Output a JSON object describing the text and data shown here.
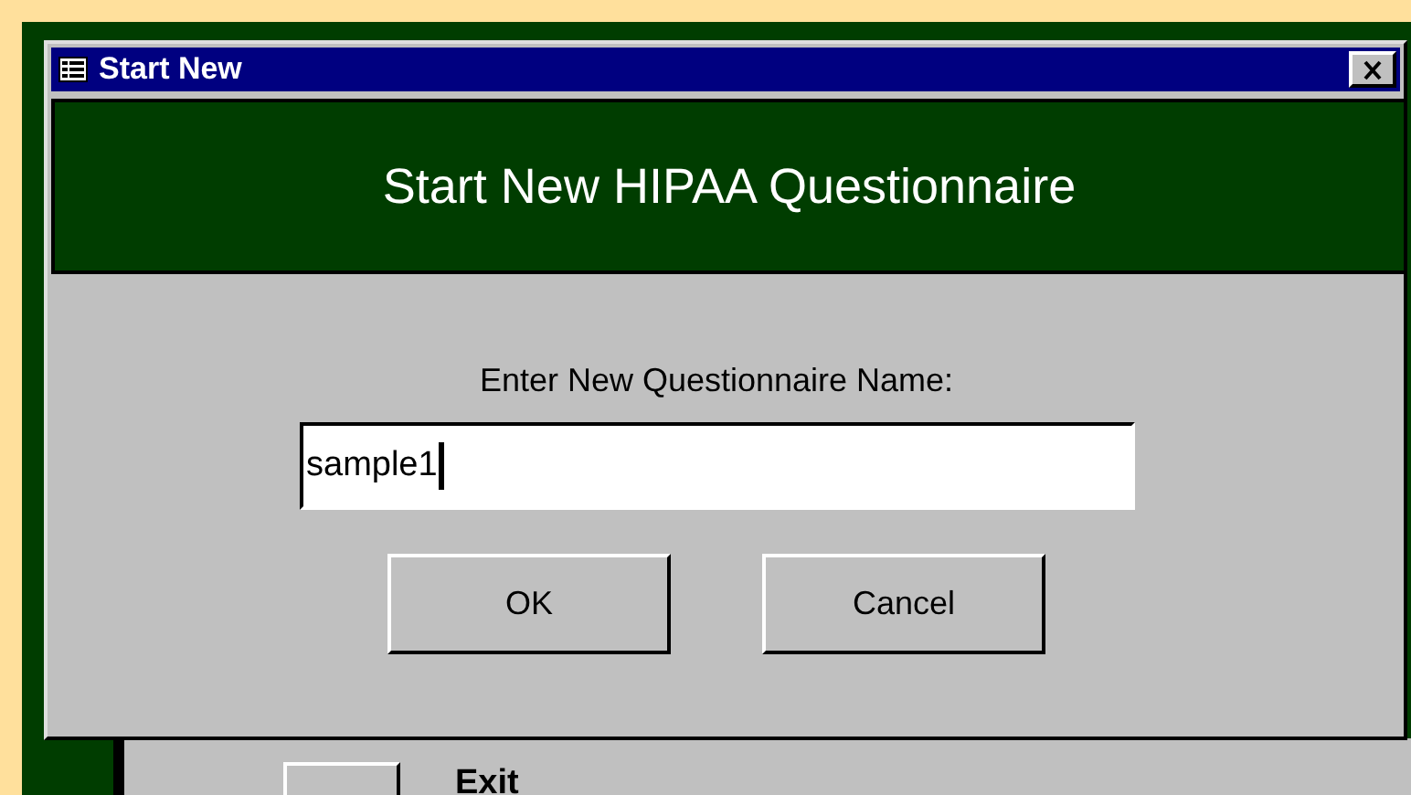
{
  "background_window": {
    "exit_label": "Exit"
  },
  "dialog": {
    "title": "Start New",
    "header": "Start New HIPAA Questionnaire",
    "prompt": "Enter New Questionnaire Name:",
    "name_field": {
      "value": "sample1"
    },
    "buttons": [
      "OK",
      "Cancel"
    ]
  }
}
